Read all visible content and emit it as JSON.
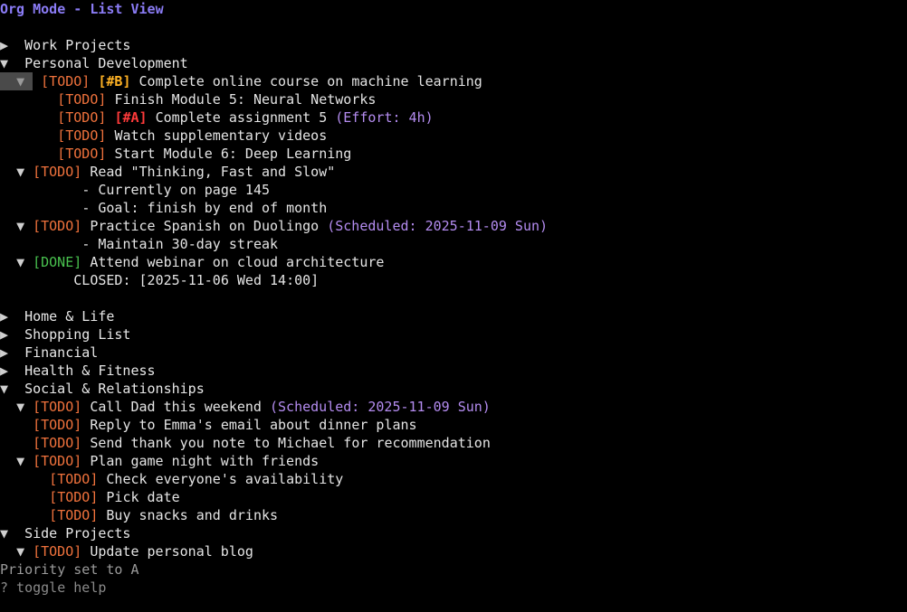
{
  "title": "Org Mode - List View",
  "glyphs": {
    "collapsed": "▶",
    "expanded": "▼"
  },
  "colors": {
    "todo": "#f0723c",
    "done": "#49c24f",
    "priority_a": "#ff3a3a",
    "priority_b": "#ffb224",
    "meta": "#b48cf0",
    "title": "#8b7cf6"
  },
  "tree": {
    "work_projects": "Work Projects",
    "personal_development": {
      "heading": "Personal Development",
      "ml_course": {
        "keyword": "[TODO]",
        "priority": "[#B]",
        "text": "Complete online course on machine learning",
        "children": [
          {
            "keyword": "[TODO]",
            "text": "Finish Module 5: Neural Networks"
          },
          {
            "keyword": "[TODO]",
            "priority": "[#A]",
            "text": "Complete assignment 5",
            "meta": "(Effort: 4h)"
          },
          {
            "keyword": "[TODO]",
            "text": "Watch supplementary videos"
          },
          {
            "keyword": "[TODO]",
            "text": "Start Module 6: Deep Learning"
          }
        ]
      },
      "reading": {
        "keyword": "[TODO]",
        "text": "Read \"Thinking, Fast and Slow\"",
        "notes": [
          "- Currently on page 145",
          "- Goal: finish by end of month"
        ]
      },
      "spanish": {
        "keyword": "[TODO]",
        "text": "Practice Spanish on Duolingo",
        "meta": "(Scheduled: 2025-11-09 Sun)",
        "notes": [
          "- Maintain 30-day streak"
        ]
      },
      "webinar": {
        "keyword": "[DONE]",
        "text": "Attend webinar on cloud architecture",
        "closed": "CLOSED: [2025-11-06 Wed 14:00]"
      }
    },
    "home_life": "Home & Life",
    "shopping_list": "Shopping List",
    "financial": "Financial",
    "health_fitness": "Health & Fitness",
    "social": {
      "heading": "Social & Relationships",
      "call_dad": {
        "keyword": "[TODO]",
        "text": "Call Dad this weekend",
        "meta": "(Scheduled: 2025-11-09 Sun)"
      },
      "reply_emma": {
        "keyword": "[TODO]",
        "text": "Reply to Emma's email about dinner plans"
      },
      "thank_michael": {
        "keyword": "[TODO]",
        "text": "Send thank you note to Michael for recommendation"
      },
      "game_night": {
        "keyword": "[TODO]",
        "text": "Plan game night with friends",
        "children": [
          {
            "keyword": "[TODO]",
            "text": "Check everyone's availability"
          },
          {
            "keyword": "[TODO]",
            "text": "Pick date"
          },
          {
            "keyword": "[TODO]",
            "text": "Buy snacks and drinks"
          }
        ]
      }
    },
    "side_projects": {
      "heading": "Side Projects",
      "blog": {
        "keyword": "[TODO]",
        "text": "Update personal blog"
      }
    }
  },
  "status_message": "Priority set to A",
  "help_hint": "? toggle help"
}
